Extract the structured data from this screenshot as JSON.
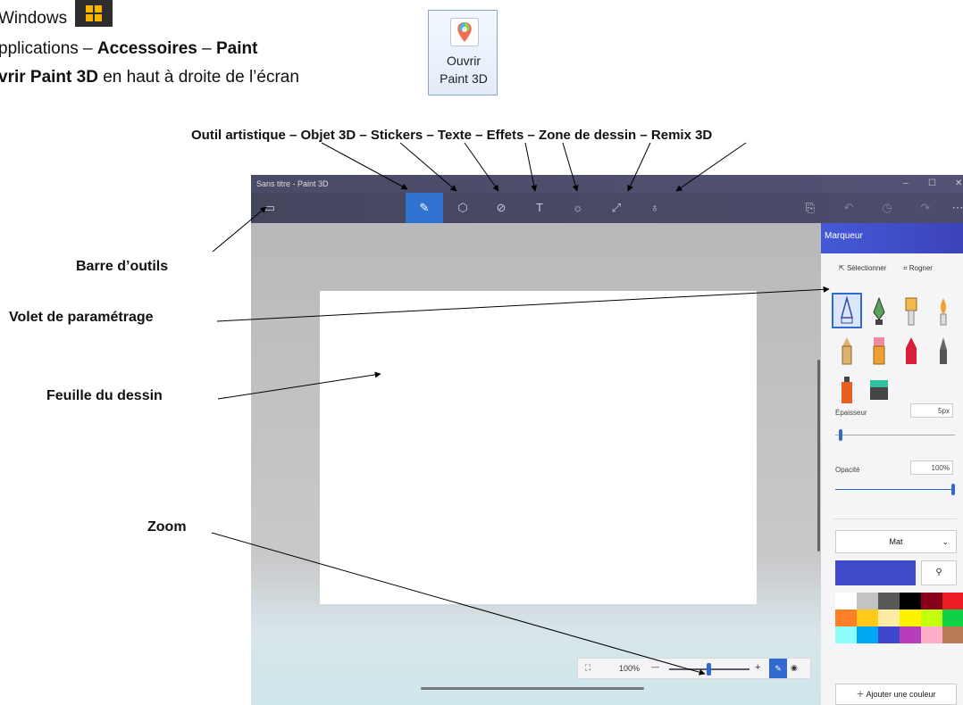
{
  "instructions": {
    "line1": "Windows",
    "line2_prefix": "pplications – ",
    "line2_bold1": "Accessoires",
    "line2_sep": " – ",
    "line2_bold2": "Paint",
    "line3_bold": "vrir Paint 3D",
    "line3_rest": " en haut à droite de l’écran"
  },
  "open_button": {
    "line1": "Ouvrir",
    "line2": "Paint 3D",
    "icon": "paint3d-logo-icon"
  },
  "callouts": {
    "top": "Outil artistique – Objet 3D – Stickers – Texte – Effets – Zone de dessin – Remix 3D",
    "toolbar": "Barre d’outils",
    "settings_pane": "Volet de paramétrage",
    "sheet": "Feuille du dessin",
    "zoom": "Zoom"
  },
  "app": {
    "title": "Sans titre - Paint 3D",
    "window_controls": {
      "minimize": "–",
      "maximize": "☐",
      "close": "✕"
    },
    "toolbar": {
      "menu": "▭",
      "tools": [
        {
          "label": "✎",
          "name": "Outil artistique"
        },
        {
          "label": "⬡",
          "name": "Objet 3D"
        },
        {
          "label": "⊘",
          "name": "Stickers"
        },
        {
          "label": "T",
          "name": "Texte"
        },
        {
          "label": "☼",
          "name": "Effets"
        },
        {
          "label": "⤢",
          "name": "Zone de dessin"
        },
        {
          "label": "♁",
          "name": "Remix 3D"
        }
      ],
      "right_icons": [
        "⎘",
        "↶",
        "◷",
        "↷",
        "⋯"
      ]
    },
    "zoom": {
      "fit": "⛶",
      "level": "100%",
      "minus": "—",
      "plus": "+",
      "zoom_fraction": 0.5
    },
    "panel": {
      "title": "Marqueur",
      "select": "Sélectionner",
      "crop": "Rogner",
      "thickness_label": "Épaisseur",
      "thickness_value": "5px",
      "thickness_fraction": 0.03,
      "opacity_label": "Opacité",
      "opacity_value": "100%",
      "opacity_fraction": 1.0,
      "finish": "Mat",
      "current_color": "#3f4acb",
      "eyedropper": "⚲",
      "palette": [
        "#ffffff",
        "#c3c3c3",
        "#585858",
        "#000000",
        "#88001b",
        "#ec1c24",
        "#ff7f27",
        "#ffca18",
        "#fdeca6",
        "#fff200",
        "#c4ff0e",
        "#0ed145",
        "#8cfffb",
        "#00a8f3",
        "#3f48cc",
        "#b83dba",
        "#ffaec8",
        "#b97a56"
      ],
      "add_color": "Ajouter une couleur"
    }
  }
}
